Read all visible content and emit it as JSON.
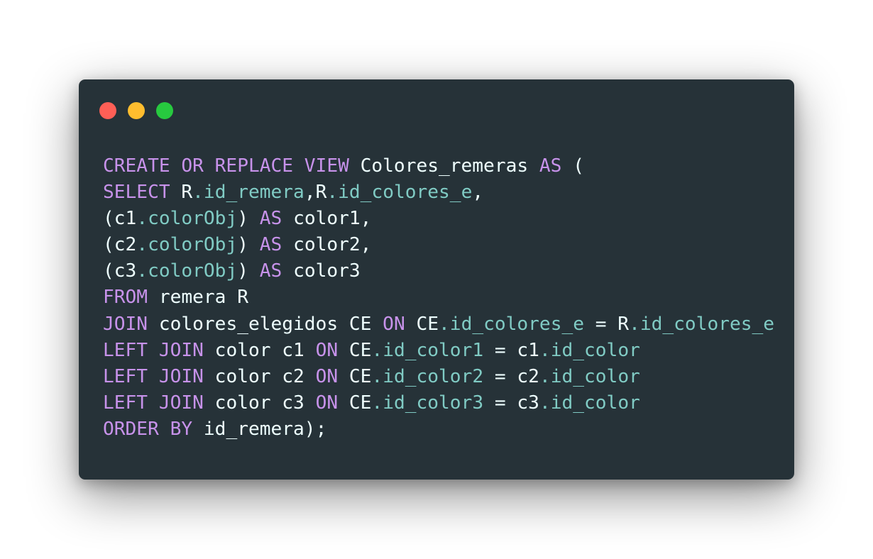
{
  "window": {
    "controls": [
      {
        "name": "close",
        "color": "#ff5f56"
      },
      {
        "name": "minimize",
        "color": "#ffbd2e"
      },
      {
        "name": "zoom",
        "color": "#27c93f"
      }
    ],
    "background": "#263238"
  },
  "colors": {
    "keyword": "#c792ea",
    "property": "#80cbc4",
    "plain": "#eeffff"
  },
  "code": {
    "language": "sql",
    "lines": [
      [
        {
          "t": "CREATE OR REPLACE VIEW",
          "k": "kw"
        },
        {
          "t": " Colores_remeras ",
          "k": "plain"
        },
        {
          "t": "AS",
          "k": "kw"
        },
        {
          "t": " (",
          "k": "plain"
        }
      ],
      [
        {
          "t": "SELECT",
          "k": "kw"
        },
        {
          "t": " R",
          "k": "plain"
        },
        {
          "t": ".id_remera",
          "k": "prop"
        },
        {
          "t": ",R",
          "k": "plain"
        },
        {
          "t": ".id_colores_e",
          "k": "prop"
        },
        {
          "t": ",",
          "k": "plain"
        }
      ],
      [
        {
          "t": "(c1",
          "k": "plain"
        },
        {
          "t": ".colorObj",
          "k": "prop"
        },
        {
          "t": ") ",
          "k": "plain"
        },
        {
          "t": "AS",
          "k": "kw"
        },
        {
          "t": " color1,",
          "k": "plain"
        }
      ],
      [
        {
          "t": "(c2",
          "k": "plain"
        },
        {
          "t": ".colorObj",
          "k": "prop"
        },
        {
          "t": ") ",
          "k": "plain"
        },
        {
          "t": "AS",
          "k": "kw"
        },
        {
          "t": " color2,",
          "k": "plain"
        }
      ],
      [
        {
          "t": "(c3",
          "k": "plain"
        },
        {
          "t": ".colorObj",
          "k": "prop"
        },
        {
          "t": ") ",
          "k": "plain"
        },
        {
          "t": "AS",
          "k": "kw"
        },
        {
          "t": " color3",
          "k": "plain"
        }
      ],
      [
        {
          "t": "FROM",
          "k": "kw"
        },
        {
          "t": " remera R",
          "k": "plain"
        }
      ],
      [
        {
          "t": "JOIN",
          "k": "kw"
        },
        {
          "t": " colores_elegidos CE ",
          "k": "plain"
        },
        {
          "t": "ON",
          "k": "kw"
        },
        {
          "t": " CE",
          "k": "plain"
        },
        {
          "t": ".id_colores_e",
          "k": "prop"
        },
        {
          "t": " = R",
          "k": "plain"
        },
        {
          "t": ".id_colores_e",
          "k": "prop"
        }
      ],
      [
        {
          "t": "LEFT JOIN",
          "k": "kw"
        },
        {
          "t": " color c1 ",
          "k": "plain"
        },
        {
          "t": "ON",
          "k": "kw"
        },
        {
          "t": " CE",
          "k": "plain"
        },
        {
          "t": ".id_color1",
          "k": "prop"
        },
        {
          "t": " = c1",
          "k": "plain"
        },
        {
          "t": ".id_color",
          "k": "prop"
        }
      ],
      [
        {
          "t": "LEFT JOIN",
          "k": "kw"
        },
        {
          "t": " color c2 ",
          "k": "plain"
        },
        {
          "t": "ON",
          "k": "kw"
        },
        {
          "t": " CE",
          "k": "plain"
        },
        {
          "t": ".id_color2",
          "k": "prop"
        },
        {
          "t": " = c2",
          "k": "plain"
        },
        {
          "t": ".id_color",
          "k": "prop"
        }
      ],
      [
        {
          "t": "LEFT JOIN",
          "k": "kw"
        },
        {
          "t": " color c3 ",
          "k": "plain"
        },
        {
          "t": "ON",
          "k": "kw"
        },
        {
          "t": " CE",
          "k": "plain"
        },
        {
          "t": ".id_color3",
          "k": "prop"
        },
        {
          "t": " = c3",
          "k": "plain"
        },
        {
          "t": ".id_color",
          "k": "prop"
        }
      ],
      [
        {
          "t": "ORDER BY",
          "k": "kw"
        },
        {
          "t": " id_remera);",
          "k": "plain"
        }
      ]
    ]
  }
}
